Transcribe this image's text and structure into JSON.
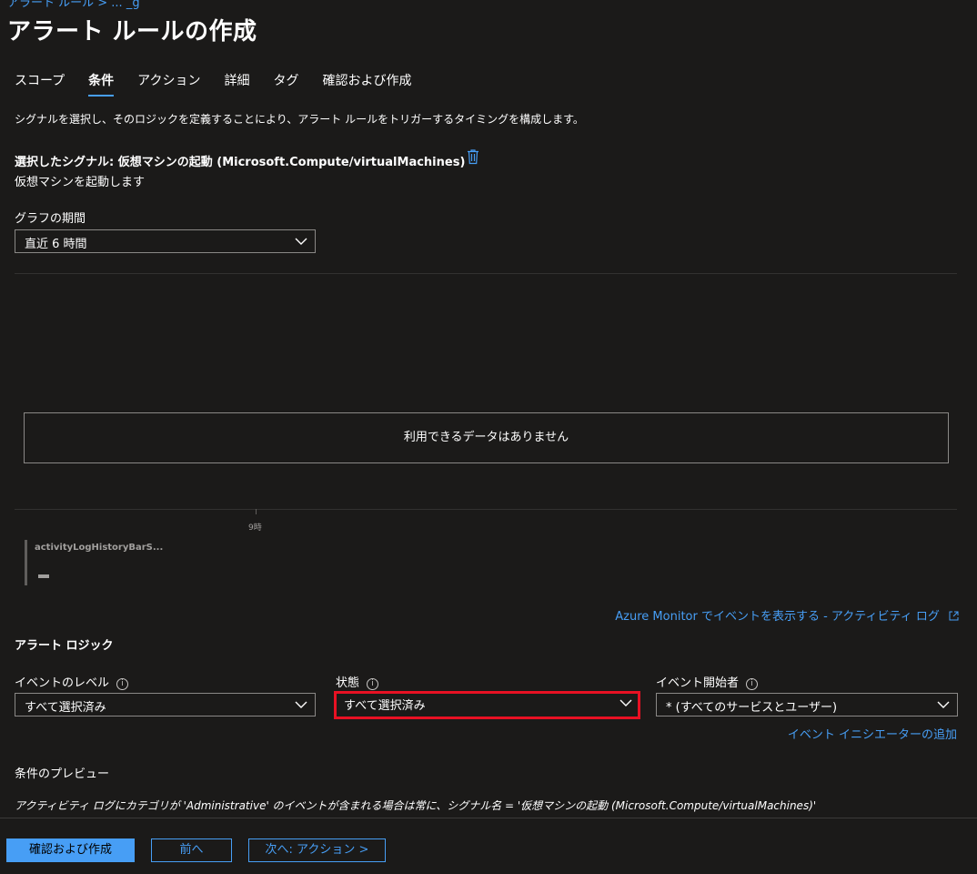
{
  "breadcrumb_partial": "アラート ルール  >  ... _g",
  "page": {
    "title": "アラート ルールの作成",
    "more": "···"
  },
  "tabs": [
    {
      "label": "スコープ",
      "active": false
    },
    {
      "label": "条件",
      "active": true
    },
    {
      "label": "アクション",
      "active": false
    },
    {
      "label": "詳細",
      "active": false
    },
    {
      "label": "タグ",
      "active": false
    },
    {
      "label": "確認および作成",
      "active": false
    }
  ],
  "description": "シグナルを選択し、そのロジックを定義することにより、アラート ルールをトリガーするタイミングを構成します。",
  "signal": {
    "selected_label": "選択したシグナル: 仮想マシンの起動 (Microsoft.Compute/virtualMachines)",
    "subtitle": "仮想マシンを起動します"
  },
  "graph_period": {
    "label": "グラフの期間",
    "value": "直近 6 時間"
  },
  "chart": {
    "no_data": "利用できるデータはありません",
    "tick_label": "9時",
    "legend_name": "activityLogHistoryBarS..."
  },
  "monitor_link": "Azure Monitor でイベントを表示する - アクティビティ ログ",
  "alert_logic": {
    "title": "アラート ロジック",
    "event_level": {
      "label": "イベントのレベル",
      "value": "すべて選択済み"
    },
    "status": {
      "label": "状態",
      "value": "すべて選択済み"
    },
    "initiator": {
      "label": "イベント開始者",
      "value": "* (すべてのサービスとユーザー)"
    },
    "add_initiator": "イベント イニシエーターの追加"
  },
  "preview": {
    "label": "条件のプレビュー",
    "text": "アクティビティ ログにカテゴリが 'Administrative' のイベントが含まれる場合は常に、シグナル名 = '仮想マシンの起動 (Microsoft.Compute/virtualMachines)'"
  },
  "footer": {
    "review_create": "確認および作成",
    "previous": "前へ",
    "next": "次へ: アクション >"
  },
  "colors": {
    "background": "#1b1a19",
    "accent": "#479ef5",
    "highlight": "#e81123"
  }
}
